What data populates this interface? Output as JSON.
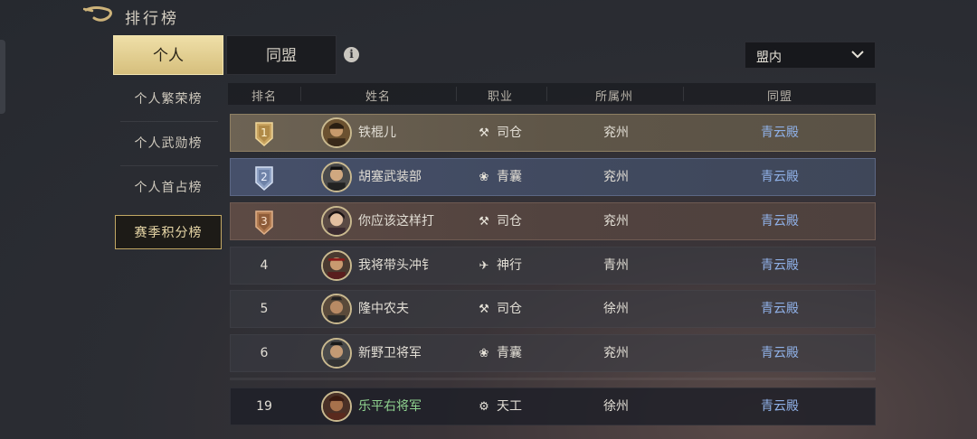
{
  "header": {
    "title": "排行榜"
  },
  "tabs": [
    {
      "label": "个人",
      "active": true
    },
    {
      "label": "同盟",
      "active": false
    }
  ],
  "info_icon": "info-icon",
  "filter": {
    "selected": "盟内"
  },
  "sidebar": {
    "items": [
      {
        "label": "个人繁荣榜",
        "active": false
      },
      {
        "label": "个人武勋榜",
        "active": false
      },
      {
        "label": "个人首占榜",
        "active": false
      },
      {
        "label": "赛季积分榜",
        "active": true
      }
    ]
  },
  "table": {
    "columns": [
      "排名",
      "姓名",
      "职业",
      "所属州",
      "同盟"
    ],
    "rows": [
      {
        "rank": "1",
        "name": "铁棍儿",
        "job": "司仓",
        "job_icon": "scythe-icon",
        "state": "兖州",
        "guild": "青云殿",
        "tier": "gold"
      },
      {
        "rank": "2",
        "name": "胡塞武装部",
        "job": "青囊",
        "job_icon": "lotus-icon",
        "state": "兖州",
        "guild": "青云殿",
        "tier": "silver"
      },
      {
        "rank": "3",
        "name": "你应该这样打",
        "job": "司仓",
        "job_icon": "scythe-icon",
        "state": "兖州",
        "guild": "青云殿",
        "tier": "bronze"
      },
      {
        "rank": "4",
        "name": "我将带头冲钅",
        "job": "神行",
        "job_icon": "bird-icon",
        "state": "青州",
        "guild": "青云殿",
        "tier": "normal"
      },
      {
        "rank": "5",
        "name": "隆中农夫",
        "job": "司仓",
        "job_icon": "scythe-icon",
        "state": "徐州",
        "guild": "青云殿",
        "tier": "normal"
      },
      {
        "rank": "6",
        "name": "新野卫将军",
        "job": "青囊",
        "job_icon": "lotus-icon",
        "state": "兖州",
        "guild": "青云殿",
        "tier": "normal"
      }
    ],
    "self_row": {
      "rank": "19",
      "name": "乐平右将军",
      "job": "天工",
      "job_icon": "gear-icon",
      "state": "徐州",
      "guild": "青云殿"
    }
  },
  "colors": {
    "accent_gold": "#d6bf7c",
    "guild_blue": "#8fb0e6",
    "self_name_green": "#8fd28f"
  }
}
